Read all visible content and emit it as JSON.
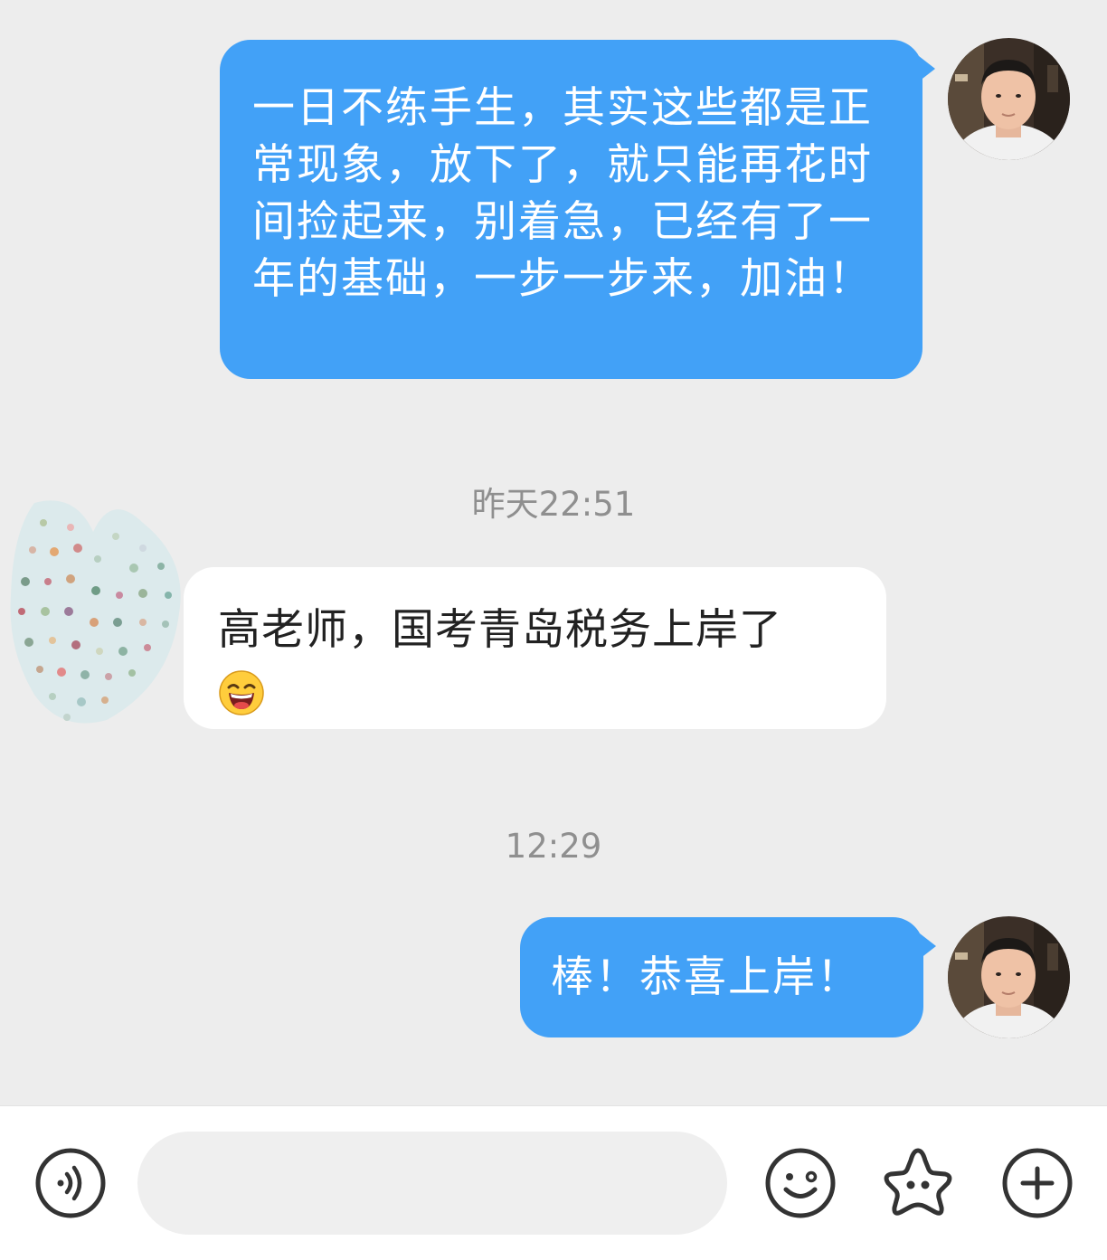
{
  "messages": [
    {
      "direction": "outgoing",
      "text": "一日不练手生，其实这些都是正常现象，放下了，就只能再花时间捡起来，别着急，已经有了一年的基础，一步一步来，加油！"
    },
    {
      "direction": "incoming",
      "text": "高老师，国考青岛税务上岸了",
      "emoji": "laughing-emoji"
    },
    {
      "direction": "outgoing",
      "text": "棒！恭喜上岸！"
    }
  ],
  "timestamps": [
    "昨天22:51",
    "12:29"
  ],
  "input_bar": {
    "placeholder": "",
    "icons": [
      "voice-icon",
      "emoji-icon",
      "sticker-icon",
      "plus-icon"
    ]
  },
  "colors": {
    "background": "#ededed",
    "outgoing_bubble": "#42a1f7",
    "incoming_bubble": "#ffffff",
    "timestamp_text": "#8f8f8f",
    "icon_stroke": "#333333"
  }
}
